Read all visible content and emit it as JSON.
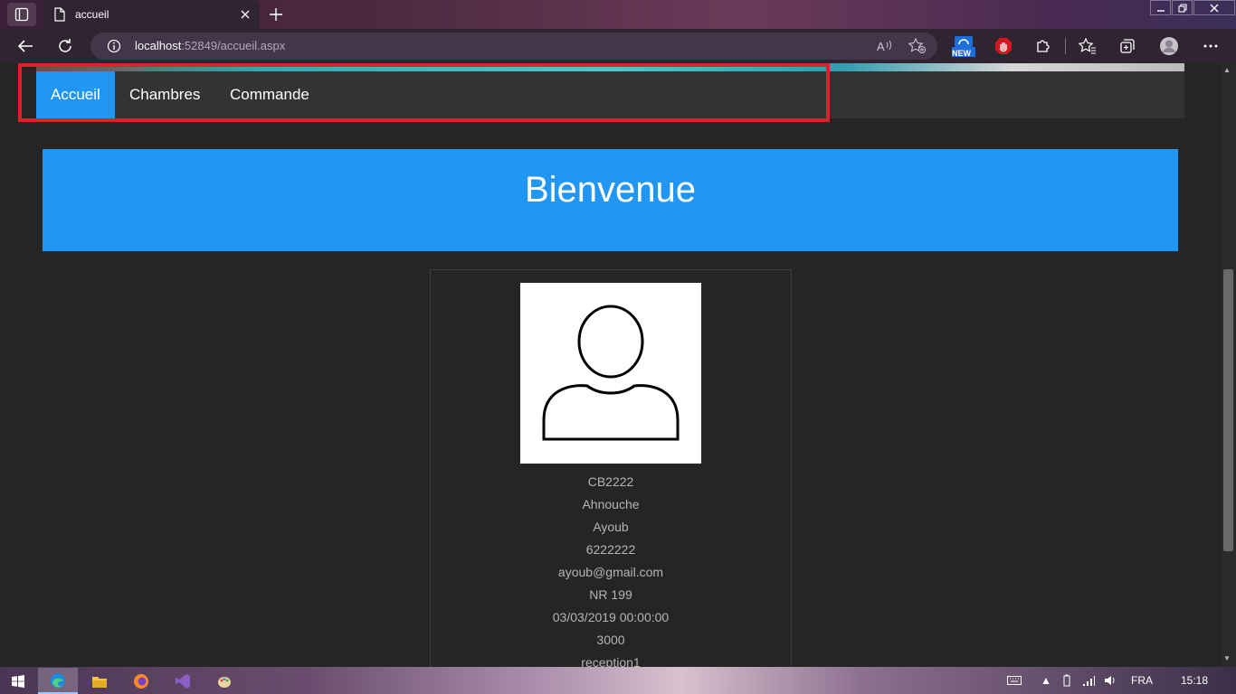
{
  "browser": {
    "tab_title": "accueil",
    "address": {
      "host": "localhost",
      "path": ":52849/accueil.aspx"
    },
    "new_badge": "NEW"
  },
  "nav": {
    "items": [
      {
        "label": "Accueil",
        "active": true
      },
      {
        "label": "Chambres",
        "active": false
      },
      {
        "label": "Commande",
        "active": false
      }
    ]
  },
  "page": {
    "banner_title": "Bienvenue",
    "profile": {
      "avatar_icon": "user-silhouette-icon",
      "fields": [
        "CB2222",
        "Ahnouche",
        "Ayoub",
        "6222222",
        "ayoub@gmail.com",
        "NR 199",
        "03/03/2019 00:00:00",
        "3000",
        "reception1"
      ]
    }
  },
  "taskbar": {
    "language": "FRA",
    "time": "15:18",
    "apps": [
      "edge-icon",
      "file-explorer-icon",
      "firefox-icon",
      "visual-studio-icon",
      "paint-icon"
    ]
  },
  "colors": {
    "accent": "#2196F3",
    "highlight": "#e0202a",
    "navbar": "#333333",
    "background": "#252525"
  }
}
